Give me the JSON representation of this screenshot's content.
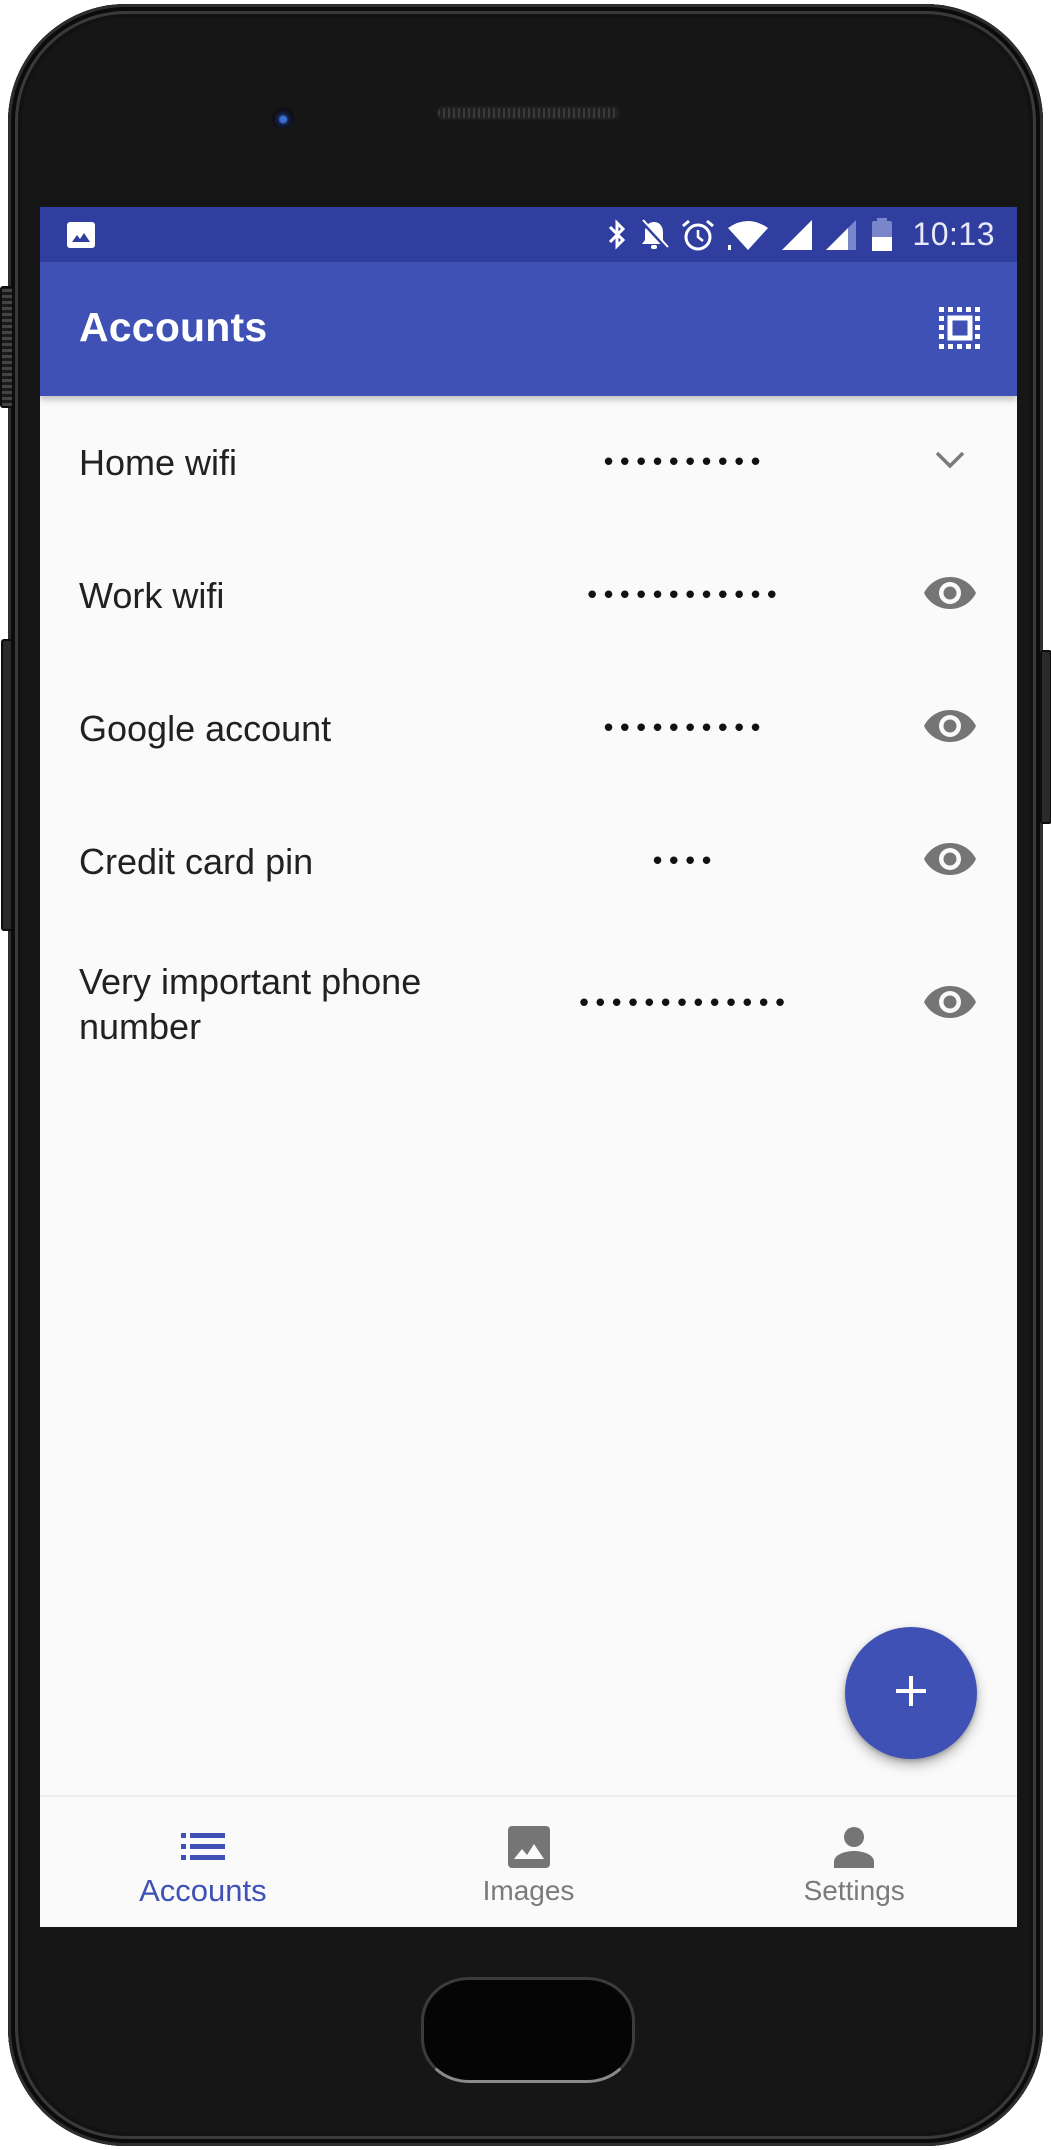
{
  "status_bar": {
    "notification_icon": "image-icon",
    "icons": [
      "bluetooth-icon",
      "notifications-off-icon",
      "alarm-icon",
      "wifi-icon",
      "signal-full-icon",
      "signal-partial-icon",
      "battery-half-icon"
    ],
    "time": "10:13"
  },
  "app_bar": {
    "title": "Accounts",
    "action_icon": "select-all-icon"
  },
  "accounts": [
    {
      "label": "Home wifi",
      "secret": "••••••••••",
      "action_icon": "chevron-down-icon"
    },
    {
      "label": "Work wifi",
      "secret": "••••••••••••",
      "action_icon": "eye-icon"
    },
    {
      "label": "Google account",
      "secret": "••••••••••",
      "action_icon": "eye-icon"
    },
    {
      "label": "Credit card pin",
      "secret": "••••",
      "action_icon": "eye-icon"
    },
    {
      "label": "Very important phone number",
      "secret": "•••••••••••••",
      "action_icon": "eye-icon"
    }
  ],
  "fab": {
    "icon": "plus-icon"
  },
  "bottom_nav": {
    "items": [
      {
        "label": "Accounts",
        "icon": "list-icon",
        "active": true
      },
      {
        "label": "Images",
        "icon": "image-icon",
        "active": false
      },
      {
        "label": "Settings",
        "icon": "person-icon",
        "active": false
      }
    ]
  },
  "colors": {
    "primary": "#3f51b5",
    "primary_dark": "#303f9f",
    "background": "#fafafa",
    "icon_gray": "#757575",
    "text_primary": "#212121"
  }
}
